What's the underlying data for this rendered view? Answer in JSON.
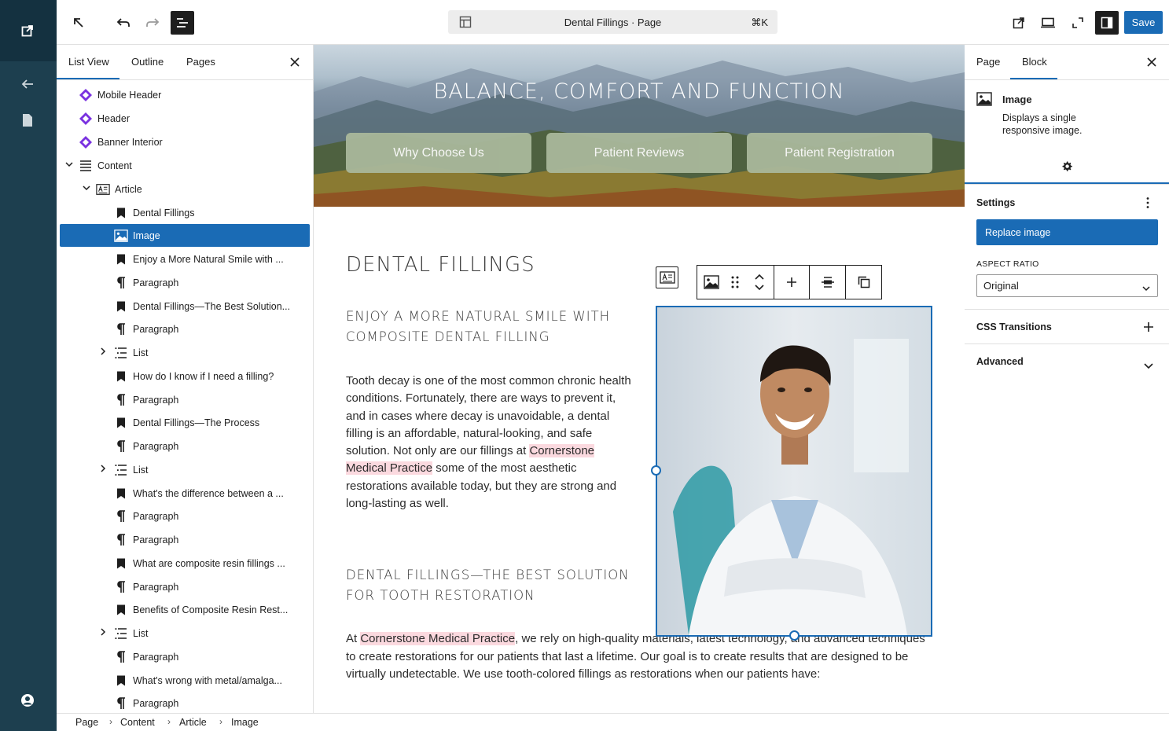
{
  "window": {
    "doc_title": "Dental Fillings · Page",
    "shortcut": "⌘K"
  },
  "toolbar": {
    "save_label": "Save"
  },
  "left_panel": {
    "tabs": [
      "List View",
      "Outline",
      "Pages"
    ],
    "items": [
      {
        "label": "Mobile Header",
        "icon": "reusable-block-icon",
        "level": 0
      },
      {
        "label": "Header",
        "icon": "reusable-block-icon",
        "level": 0
      },
      {
        "label": "Banner Interior",
        "icon": "reusable-block-icon",
        "level": 0
      },
      {
        "label": "Content",
        "icon": "post-content-icon",
        "level": 0,
        "expanded": true
      },
      {
        "label": "Article",
        "icon": "article-icon",
        "level": 1,
        "expanded": true
      },
      {
        "label": "Dental Fillings",
        "icon": "heading-bookmark-icon",
        "level": 2
      },
      {
        "label": "Image",
        "icon": "image-icon",
        "level": 2,
        "selected": true
      },
      {
        "label": "Enjoy a More Natural Smile with ...",
        "icon": "heading-bookmark-icon",
        "level": 2
      },
      {
        "label": "Paragraph",
        "icon": "paragraph-icon",
        "level": 2
      },
      {
        "label": "Dental Fillings—The Best Solution...",
        "icon": "heading-bookmark-icon",
        "level": 2
      },
      {
        "label": "Paragraph",
        "icon": "paragraph-icon",
        "level": 2
      },
      {
        "label": "List",
        "icon": "list-icon",
        "level": 2,
        "collapsed": true
      },
      {
        "label": "How do I know if I need a filling?",
        "icon": "heading-bookmark-icon",
        "level": 2
      },
      {
        "label": "Paragraph",
        "icon": "paragraph-icon",
        "level": 2
      },
      {
        "label": "Dental Fillings—The Process",
        "icon": "heading-bookmark-icon",
        "level": 2
      },
      {
        "label": "Paragraph",
        "icon": "paragraph-icon",
        "level": 2
      },
      {
        "label": "List",
        "icon": "list-icon",
        "level": 2,
        "collapsed": true
      },
      {
        "label": "What's the difference between a ...",
        "icon": "heading-bookmark-icon",
        "level": 2
      },
      {
        "label": "Paragraph",
        "icon": "paragraph-icon",
        "level": 2
      },
      {
        "label": "Paragraph",
        "icon": "paragraph-icon",
        "level": 2
      },
      {
        "label": "What are composite resin fillings ...",
        "icon": "heading-bookmark-icon",
        "level": 2
      },
      {
        "label": "Paragraph",
        "icon": "paragraph-icon",
        "level": 2
      },
      {
        "label": "Benefits of Composite Resin Rest...",
        "icon": "heading-bookmark-icon",
        "level": 2
      },
      {
        "label": "List",
        "icon": "list-icon",
        "level": 2,
        "collapsed": true
      },
      {
        "label": "Paragraph",
        "icon": "paragraph-icon",
        "level": 2
      },
      {
        "label": "What's wrong with metal/amalga...",
        "icon": "heading-bookmark-icon",
        "level": 2
      },
      {
        "label": "Paragraph",
        "icon": "paragraph-icon",
        "level": 2
      }
    ]
  },
  "canvas": {
    "banner_title": "BALANCE, COMFORT AND FUNCTION",
    "banner_buttons": [
      "Why Choose Us",
      "Patient Reviews",
      "Patient Registration"
    ],
    "h1": "DENTAL FILLINGS",
    "h2a": "ENJOY A MORE NATURAL SMILE WITH COMPOSITE DENTAL FILLING",
    "p1_a": "Tooth decay is one of the most common chronic health conditions. Fortunately, there are ways to prevent it, and in cases where decay is unavoidable, a dental filling is an affordable, natural-looking, and safe solution. Not only are our fillings at ",
    "p1_hl": "Cornerstone Medical Practice",
    "p1_b": " some of the most aesthetic restorations available today, but they are strong and long-lasting as well.",
    "h2b": "DENTAL FILLINGS—THE BEST SOLUTION FOR TOOTH RESTORATION",
    "p2_a": "At ",
    "p2_hl": "Cornerstone Medical Practice",
    "p2_b": ", we rely on high-quality materials, latest technology, and advanced techniques to create restorations for our patients that last a lifetime. Our goal is to create results that are designed to be virtually undetectable. We use tooth-colored fillings as restorations when our patients have:"
  },
  "inspector": {
    "tabs": [
      "Page",
      "Block"
    ],
    "block_name": "Image",
    "block_desc": "Displays a single responsive image.",
    "settings_label": "Settings",
    "replace_label": "Replace image",
    "aspect_label": "ASPECT RATIO",
    "aspect_value": "Original",
    "css_transitions": "CSS Transitions",
    "advanced": "Advanced"
  },
  "breadcrumb": [
    "Page",
    "Content",
    "Article",
    "Image"
  ],
  "colors": {
    "accent": "#1a6bb5",
    "admin_bar": "#1d3f4f",
    "highlight": "#fbd9df",
    "banner_button": "#a9b89b",
    "reusable": "#7a32e0"
  }
}
